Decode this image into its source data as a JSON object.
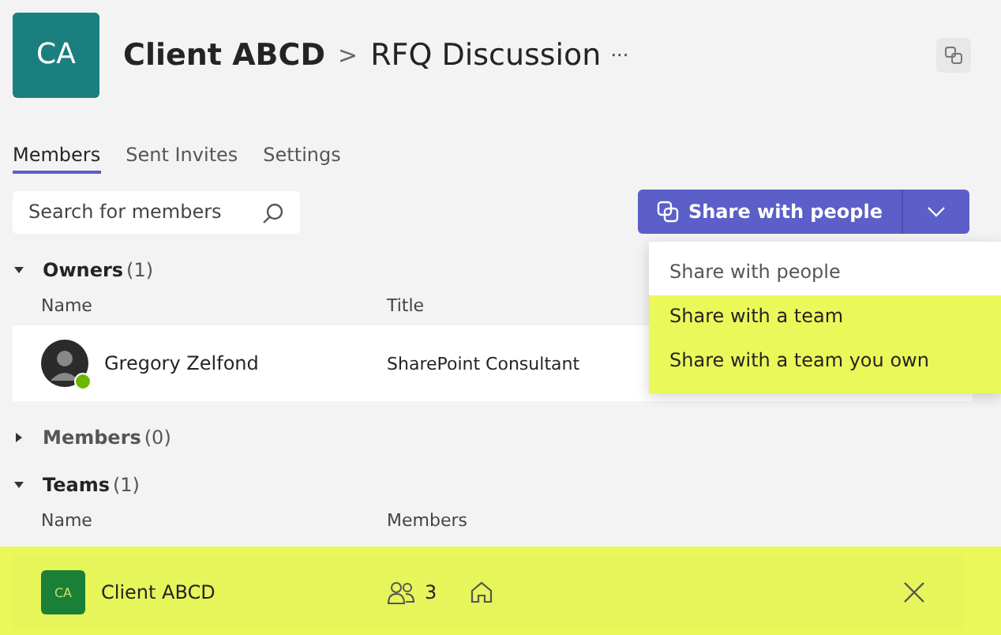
{
  "header": {
    "avatar": "CA",
    "team": "Client ABCD",
    "separator": ">",
    "channel": "RFQ Discussion",
    "more": "···"
  },
  "tabs": [
    {
      "label": "Members",
      "selected": true
    },
    {
      "label": "Sent Invites",
      "selected": false
    },
    {
      "label": "Settings",
      "selected": false
    }
  ],
  "search": {
    "placeholder": "Search for members"
  },
  "share_button": {
    "label": "Share with people"
  },
  "share_menu": {
    "items": [
      {
        "label": "Share with people",
        "kind": "header",
        "highlighted": false
      },
      {
        "label": "Share with a team",
        "kind": "option",
        "highlighted": true
      },
      {
        "label": "Share with a team you own",
        "kind": "option",
        "highlighted": true
      }
    ]
  },
  "sections": [
    {
      "title": "Owners",
      "count": "(1)",
      "expanded": true,
      "columns": [
        "Name",
        "Title"
      ],
      "rows": [
        {
          "kind": "person",
          "name": "Gregory Zelfond",
          "title": "SharePoint Consultant",
          "highlighted": false
        }
      ]
    },
    {
      "title": "Members",
      "count": "(0)",
      "expanded": false
    },
    {
      "title": "Teams",
      "count": "(1)",
      "expanded": true,
      "columns": [
        "Name",
        "Members"
      ],
      "rows": [
        {
          "kind": "team",
          "avatar": "CA",
          "name": "Client ABCD",
          "members": "3",
          "highlighted": true
        }
      ]
    }
  ]
}
